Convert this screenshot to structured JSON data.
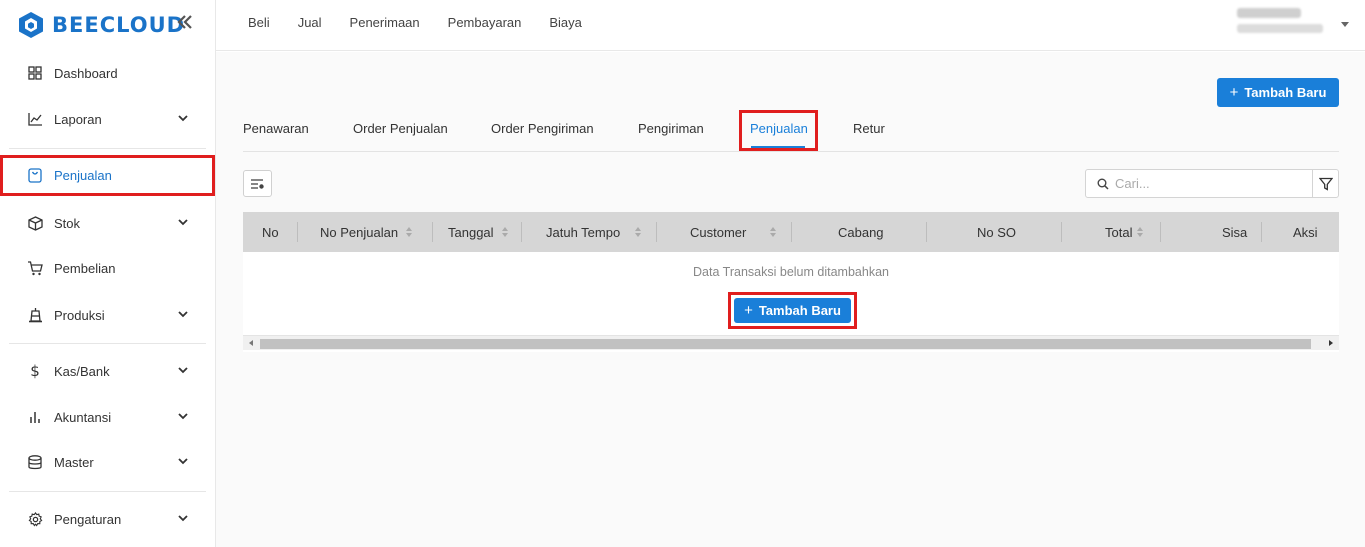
{
  "brand": {
    "name": "BEECLOUD",
    "color": "#1a73c8",
    "logo_icon": "hexagon-logo"
  },
  "sidebar": {
    "collapse_icon": "double-chevron-left-icon",
    "items": [
      {
        "label": "Dashboard",
        "icon": "grid-icon",
        "expandable": false
      },
      {
        "label": "Laporan",
        "icon": "line-chart-icon",
        "expandable": true
      },
      {
        "label": "Penjualan",
        "icon": "bag-icon",
        "expandable": false,
        "active": true
      },
      {
        "label": "Stok",
        "icon": "box-icon",
        "expandable": true
      },
      {
        "label": "Pembelian",
        "icon": "cart-icon",
        "expandable": false
      },
      {
        "label": "Produksi",
        "icon": "factory-icon",
        "expandable": true
      },
      {
        "label": "Kas/Bank",
        "icon": "dollar-icon",
        "expandable": true
      },
      {
        "label": "Akuntansi",
        "icon": "bar-chart-icon",
        "expandable": true
      },
      {
        "label": "Master",
        "icon": "database-icon",
        "expandable": true
      },
      {
        "label": "Pengaturan",
        "icon": "gear-icon",
        "expandable": true
      }
    ]
  },
  "topbar": {
    "menu": [
      "Beli",
      "Jual",
      "Penerimaan",
      "Pembayaran",
      "Biaya"
    ]
  },
  "main": {
    "add_button_label": "Tambah Baru",
    "tabs": [
      "Penawaran",
      "Order Penjualan",
      "Order Pengiriman",
      "Pengiriman",
      "Penjualan",
      "Retur"
    ],
    "active_tab": "Penjualan",
    "search_placeholder": "Cari...",
    "table": {
      "columns": [
        {
          "label": "No",
          "sortable": false
        },
        {
          "label": "No Penjualan",
          "sortable": true
        },
        {
          "label": "Tanggal",
          "sortable": true
        },
        {
          "label": "Jatuh Tempo",
          "sortable": true
        },
        {
          "label": "Customer",
          "sortable": true
        },
        {
          "label": "Cabang",
          "sortable": false
        },
        {
          "label": "No SO",
          "sortable": false
        },
        {
          "label": "Total",
          "sortable": true
        },
        {
          "label": "Sisa",
          "sortable": false
        },
        {
          "label": "Aksi",
          "sortable": false
        }
      ],
      "empty_message": "Data Transaksi belum ditambahkan",
      "empty_button_label": "Tambah Baru"
    }
  },
  "colors": {
    "primary": "#1a7fd9",
    "highlight": "#e01e1e",
    "header_bg": "#d6d6d6"
  }
}
